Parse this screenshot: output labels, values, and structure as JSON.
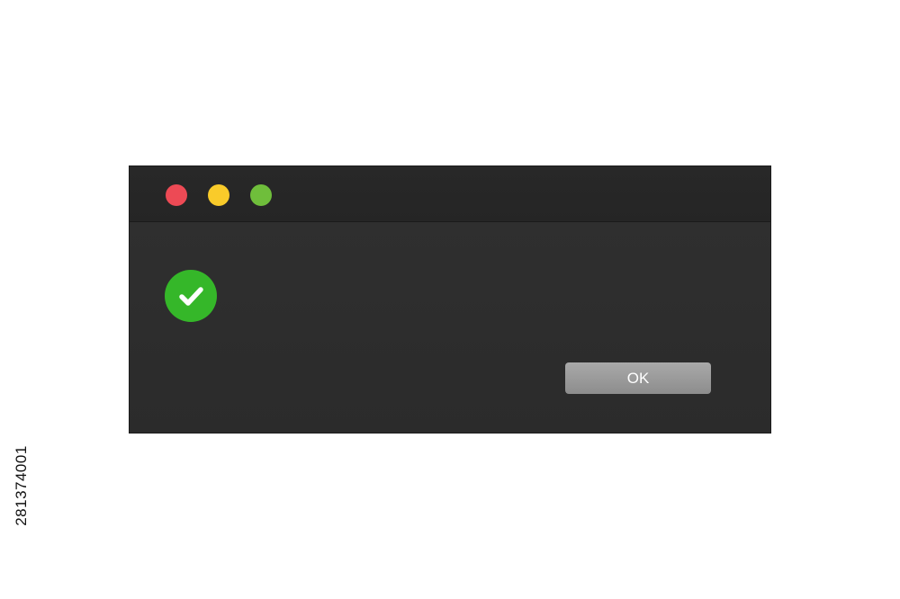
{
  "window": {
    "traffic_lights": {
      "close_color": "#ed4a55",
      "minimize_color": "#f9cb2a",
      "zoom_color": "#6fbe3b"
    },
    "status_icon": "check-circle-icon",
    "status_color": "#35b729",
    "ok_label": "OK"
  },
  "watermark": {
    "stock_id": "281374001"
  }
}
